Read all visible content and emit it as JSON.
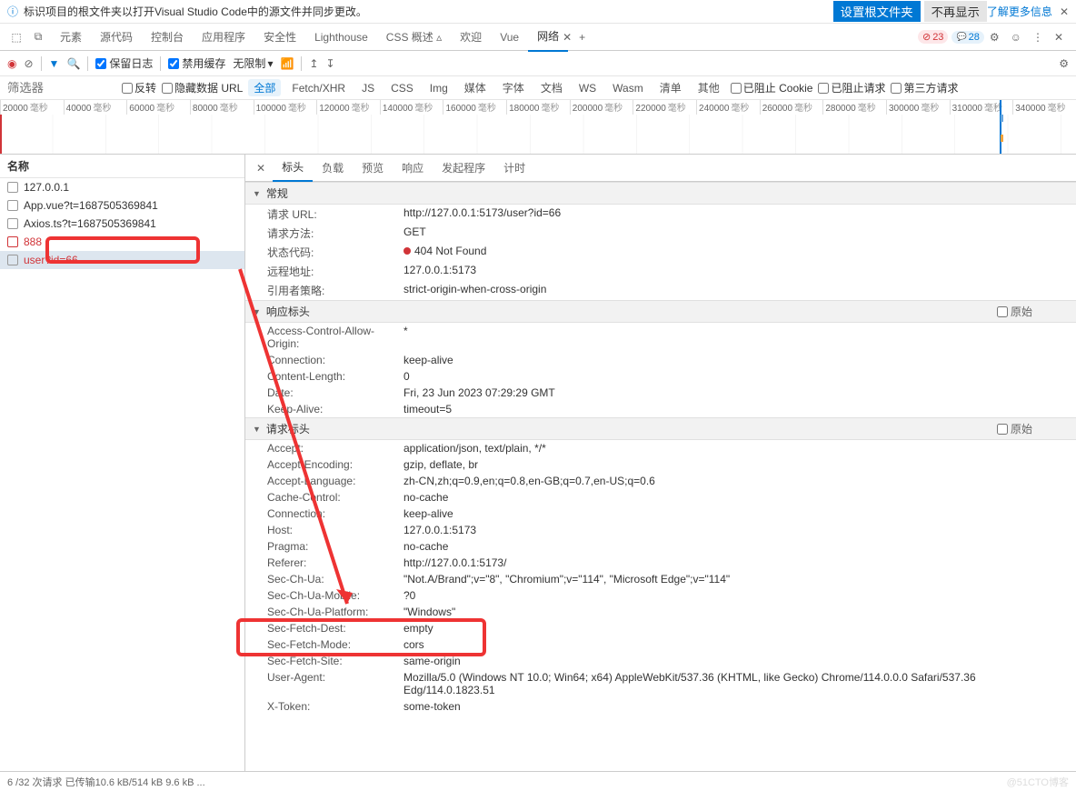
{
  "notification": {
    "message": "标识项目的根文件夹以打开Visual Studio Code中的源文件并同步更改。",
    "btn_primary": "设置根文件夹",
    "btn_secondary": "不再显示",
    "link": "了解更多信息"
  },
  "tabs": {
    "items": [
      "元素",
      "源代码",
      "控制台",
      "应用程序",
      "安全性",
      "Lighthouse",
      "CSS 概述 ▵",
      "欢迎",
      "Vue",
      "网络"
    ],
    "active_index": 9,
    "err_count": "23",
    "msg_count": "28"
  },
  "toolbar": {
    "preserve_log": "保留日志",
    "disable_cache": "禁用缓存",
    "throttle": "无限制"
  },
  "filter": {
    "placeholder": "筛选器",
    "invert": "反转",
    "hide_data_url": "隐藏数据 URL",
    "types": [
      "全部",
      "Fetch/XHR",
      "JS",
      "CSS",
      "Img",
      "媒体",
      "字体",
      "文档",
      "WS",
      "Wasm",
      "清单",
      "其他"
    ],
    "active_type_index": 0,
    "blocked_cookies": "已阻止 Cookie",
    "blocked_requests": "已阻止请求",
    "third_party": "第三方请求"
  },
  "timeline": {
    "ticks": [
      "20000",
      "40000",
      "60000",
      "80000",
      "100000",
      "120000",
      "140000",
      "160000",
      "180000",
      "200000",
      "220000",
      "240000",
      "260000",
      "280000",
      "300000",
      "310000",
      "340000"
    ],
    "unit": "毫秒"
  },
  "requests": {
    "header": "名称",
    "items": [
      {
        "name": "127.0.0.1",
        "color": "normal",
        "icon": "gray"
      },
      {
        "name": "App.vue?t=1687505369841",
        "color": "normal",
        "icon": "gray"
      },
      {
        "name": "Axios.ts?t=1687505369841",
        "color": "normal",
        "icon": "gray"
      },
      {
        "name": "888",
        "color": "red",
        "icon": "red"
      },
      {
        "name": "user?id=66",
        "color": "red",
        "icon": "gray",
        "selected": true
      }
    ]
  },
  "detail_tabs": {
    "items": [
      "标头",
      "负载",
      "预览",
      "响应",
      "发起程序",
      "计时"
    ],
    "active_index": 0
  },
  "general": {
    "title": "常规",
    "rows": [
      {
        "k": "请求 URL:",
        "v": "http://127.0.0.1:5173/user?id=66"
      },
      {
        "k": "请求方法:",
        "v": "GET"
      },
      {
        "k": "状态代码:",
        "v": "404 Not Found",
        "status": true
      },
      {
        "k": "远程地址:",
        "v": "127.0.0.1:5173"
      },
      {
        "k": "引用者策略:",
        "v": "strict-origin-when-cross-origin"
      }
    ]
  },
  "response_headers": {
    "title": "响应标头",
    "raw": "原始",
    "rows": [
      {
        "k": "Access-Control-Allow-Origin:",
        "v": "*"
      },
      {
        "k": "Connection:",
        "v": "keep-alive"
      },
      {
        "k": "Content-Length:",
        "v": "0"
      },
      {
        "k": "Date:",
        "v": "Fri, 23 Jun 2023 07:29:29 GMT"
      },
      {
        "k": "Keep-Alive:",
        "v": "timeout=5"
      }
    ]
  },
  "request_headers": {
    "title": "请求标头",
    "raw": "原始",
    "rows": [
      {
        "k": "Accept:",
        "v": "application/json, text/plain, */*"
      },
      {
        "k": "Accept-Encoding:",
        "v": "gzip, deflate, br"
      },
      {
        "k": "Accept-Language:",
        "v": "zh-CN,zh;q=0.9,en;q=0.8,en-GB;q=0.7,en-US;q=0.6"
      },
      {
        "k": "Cache-Control:",
        "v": "no-cache"
      },
      {
        "k": "Connection:",
        "v": "keep-alive"
      },
      {
        "k": "Host:",
        "v": "127.0.0.1:5173"
      },
      {
        "k": "Pragma:",
        "v": "no-cache"
      },
      {
        "k": "Referer:",
        "v": "http://127.0.0.1:5173/"
      },
      {
        "k": "Sec-Ch-Ua:",
        "v": "\"Not.A/Brand\";v=\"8\", \"Chromium\";v=\"114\", \"Microsoft Edge\";v=\"114\""
      },
      {
        "k": "Sec-Ch-Ua-Mobile:",
        "v": "?0"
      },
      {
        "k": "Sec-Ch-Ua-Platform:",
        "v": "\"Windows\""
      },
      {
        "k": "Sec-Fetch-Dest:",
        "v": "empty"
      },
      {
        "k": "Sec-Fetch-Mode:",
        "v": "cors"
      },
      {
        "k": "Sec-Fetch-Site:",
        "v": "same-origin"
      },
      {
        "k": "User-Agent:",
        "v": "Mozilla/5.0 (Windows NT 10.0; Win64; x64) AppleWebKit/537.36 (KHTML, like Gecko) Chrome/114.0.0.0 Safari/537.36 Edg/114.0.1823.51"
      },
      {
        "k": "X-Token:",
        "v": "some-token"
      }
    ]
  },
  "status_bar": {
    "text": "6 /32 次请求   已传输10.6 kB/514 kB   9.6 kB ...",
    "watermark": "@51CTO博客"
  }
}
